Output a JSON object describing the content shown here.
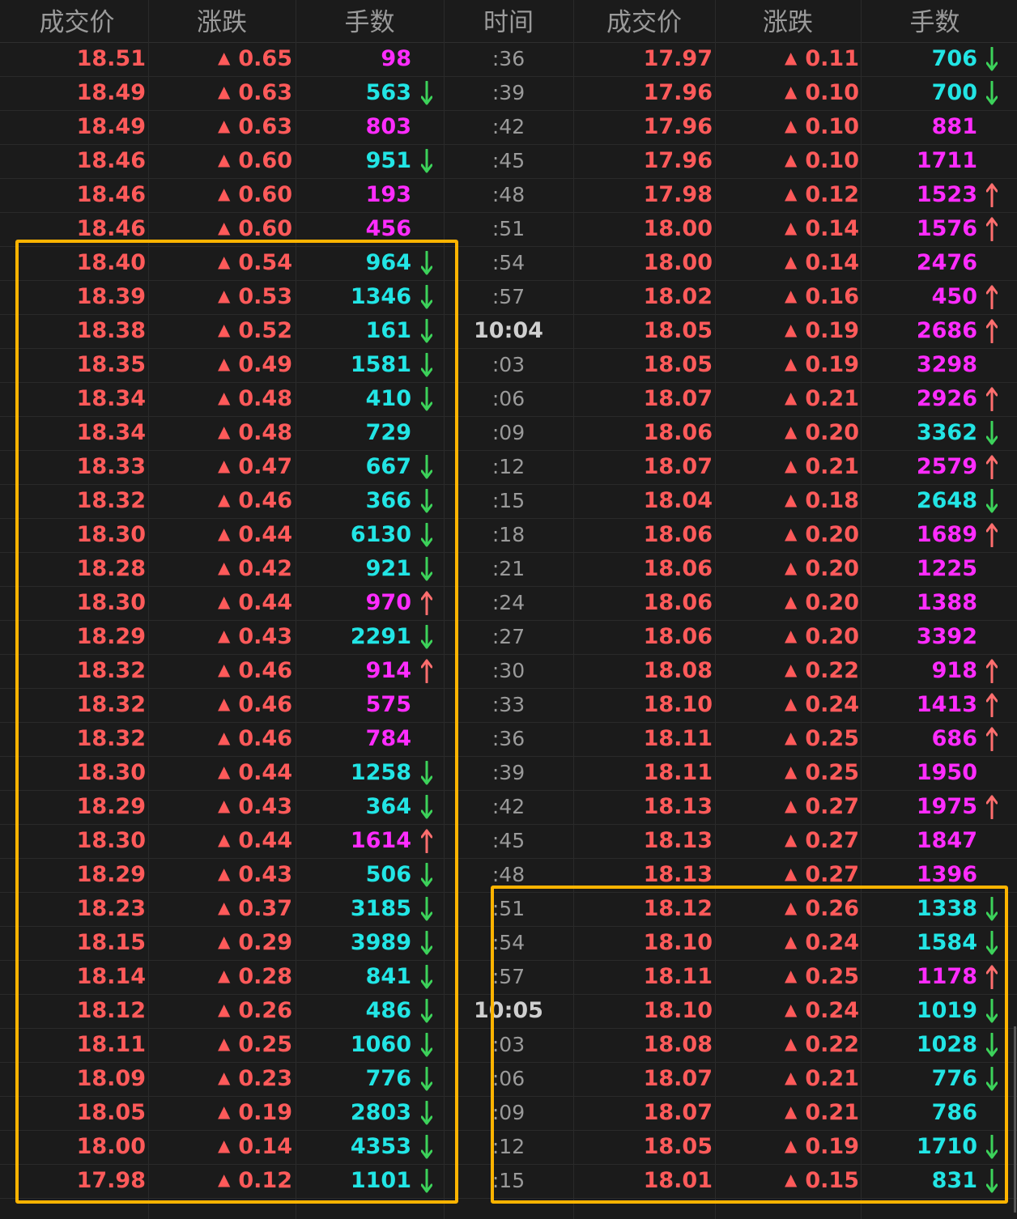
{
  "headers": {
    "price": "成交价",
    "change": "涨跌",
    "volume": "手数",
    "time": "时间"
  },
  "colors": {
    "up": "#ff5a5a",
    "buy_volume": "#ff2cff",
    "sell_volume": "#22e5e5",
    "up_arrow": "#ff6e6e",
    "down_arrow": "#3cd25a",
    "highlight": "#ffb400",
    "background": "#1b1b1b"
  },
  "change_icon": "up-triangle-icon",
  "rows": [
    {
      "lp": "18.51",
      "lc": "0.65",
      "lv": "98",
      "lk": "buy",
      "la": "",
      "t": ":36",
      "rp": "17.97",
      "rc": "0.11",
      "rv": "706",
      "rk": "sell",
      "ra": "down"
    },
    {
      "lp": "18.49",
      "lc": "0.63",
      "lv": "563",
      "lk": "sell",
      "la": "down",
      "t": ":39",
      "rp": "17.96",
      "rc": "0.10",
      "rv": "700",
      "rk": "sell",
      "ra": "down"
    },
    {
      "lp": "18.49",
      "lc": "0.63",
      "lv": "803",
      "lk": "buy",
      "la": "",
      "t": ":42",
      "rp": "17.96",
      "rc": "0.10",
      "rv": "881",
      "rk": "buy",
      "ra": ""
    },
    {
      "lp": "18.46",
      "lc": "0.60",
      "lv": "951",
      "lk": "sell",
      "la": "down",
      "t": ":45",
      "rp": "17.96",
      "rc": "0.10",
      "rv": "1711",
      "rk": "buy",
      "ra": ""
    },
    {
      "lp": "18.46",
      "lc": "0.60",
      "lv": "193",
      "lk": "buy",
      "la": "",
      "t": ":48",
      "rp": "17.98",
      "rc": "0.12",
      "rv": "1523",
      "rk": "buy",
      "ra": "up"
    },
    {
      "lp": "18.46",
      "lc": "0.60",
      "lv": "456",
      "lk": "buy",
      "la": "",
      "t": ":51",
      "rp": "18.00",
      "rc": "0.14",
      "rv": "1576",
      "rk": "buy",
      "ra": "up"
    },
    {
      "lp": "18.40",
      "lc": "0.54",
      "lv": "964",
      "lk": "sell",
      "la": "down",
      "t": ":54",
      "rp": "18.00",
      "rc": "0.14",
      "rv": "2476",
      "rk": "buy",
      "ra": ""
    },
    {
      "lp": "18.39",
      "lc": "0.53",
      "lv": "1346",
      "lk": "sell",
      "la": "down",
      "t": ":57",
      "rp": "18.02",
      "rc": "0.16",
      "rv": "450",
      "rk": "buy",
      "ra": "up"
    },
    {
      "lp": "18.38",
      "lc": "0.52",
      "lv": "161",
      "lk": "sell",
      "la": "down",
      "t": "10:04",
      "major": true,
      "rp": "18.05",
      "rc": "0.19",
      "rv": "2686",
      "rk": "buy",
      "ra": "up"
    },
    {
      "lp": "18.35",
      "lc": "0.49",
      "lv": "1581",
      "lk": "sell",
      "la": "down",
      "t": ":03",
      "rp": "18.05",
      "rc": "0.19",
      "rv": "3298",
      "rk": "buy",
      "ra": ""
    },
    {
      "lp": "18.34",
      "lc": "0.48",
      "lv": "410",
      "lk": "sell",
      "la": "down",
      "t": ":06",
      "rp": "18.07",
      "rc": "0.21",
      "rv": "2926",
      "rk": "buy",
      "ra": "up"
    },
    {
      "lp": "18.34",
      "lc": "0.48",
      "lv": "729",
      "lk": "sell",
      "la": "",
      "t": ":09",
      "rp": "18.06",
      "rc": "0.20",
      "rv": "3362",
      "rk": "sell",
      "ra": "down"
    },
    {
      "lp": "18.33",
      "lc": "0.47",
      "lv": "667",
      "lk": "sell",
      "la": "down",
      "t": ":12",
      "rp": "18.07",
      "rc": "0.21",
      "rv": "2579",
      "rk": "buy",
      "ra": "up"
    },
    {
      "lp": "18.32",
      "lc": "0.46",
      "lv": "366",
      "lk": "sell",
      "la": "down",
      "t": ":15",
      "rp": "18.04",
      "rc": "0.18",
      "rv": "2648",
      "rk": "sell",
      "ra": "down"
    },
    {
      "lp": "18.30",
      "lc": "0.44",
      "lv": "6130",
      "lk": "sell",
      "la": "down",
      "t": ":18",
      "rp": "18.06",
      "rc": "0.20",
      "rv": "1689",
      "rk": "buy",
      "ra": "up"
    },
    {
      "lp": "18.28",
      "lc": "0.42",
      "lv": "921",
      "lk": "sell",
      "la": "down",
      "t": ":21",
      "rp": "18.06",
      "rc": "0.20",
      "rv": "1225",
      "rk": "buy",
      "ra": ""
    },
    {
      "lp": "18.30",
      "lc": "0.44",
      "lv": "970",
      "lk": "buy",
      "la": "up",
      "t": ":24",
      "rp": "18.06",
      "rc": "0.20",
      "rv": "1388",
      "rk": "buy",
      "ra": ""
    },
    {
      "lp": "18.29",
      "lc": "0.43",
      "lv": "2291",
      "lk": "sell",
      "la": "down",
      "t": ":27",
      "rp": "18.06",
      "rc": "0.20",
      "rv": "3392",
      "rk": "buy",
      "ra": ""
    },
    {
      "lp": "18.32",
      "lc": "0.46",
      "lv": "914",
      "lk": "buy",
      "la": "up",
      "t": ":30",
      "rp": "18.08",
      "rc": "0.22",
      "rv": "918",
      "rk": "buy",
      "ra": "up"
    },
    {
      "lp": "18.32",
      "lc": "0.46",
      "lv": "575",
      "lk": "buy",
      "la": "",
      "t": ":33",
      "rp": "18.10",
      "rc": "0.24",
      "rv": "1413",
      "rk": "buy",
      "ra": "up"
    },
    {
      "lp": "18.32",
      "lc": "0.46",
      "lv": "784",
      "lk": "buy",
      "la": "",
      "t": ":36",
      "rp": "18.11",
      "rc": "0.25",
      "rv": "686",
      "rk": "buy",
      "ra": "up"
    },
    {
      "lp": "18.30",
      "lc": "0.44",
      "lv": "1258",
      "lk": "sell",
      "la": "down",
      "t": ":39",
      "rp": "18.11",
      "rc": "0.25",
      "rv": "1950",
      "rk": "buy",
      "ra": ""
    },
    {
      "lp": "18.29",
      "lc": "0.43",
      "lv": "364",
      "lk": "sell",
      "la": "down",
      "t": ":42",
      "rp": "18.13",
      "rc": "0.27",
      "rv": "1975",
      "rk": "buy",
      "ra": "up"
    },
    {
      "lp": "18.30",
      "lc": "0.44",
      "lv": "1614",
      "lk": "buy",
      "la": "up",
      "t": ":45",
      "rp": "18.13",
      "rc": "0.27",
      "rv": "1847",
      "rk": "buy",
      "ra": ""
    },
    {
      "lp": "18.29",
      "lc": "0.43",
      "lv": "506",
      "lk": "sell",
      "la": "down",
      "t": ":48",
      "rp": "18.13",
      "rc": "0.27",
      "rv": "1396",
      "rk": "buy",
      "ra": ""
    },
    {
      "lp": "18.23",
      "lc": "0.37",
      "lv": "3185",
      "lk": "sell",
      "la": "down",
      "t": ":51",
      "rp": "18.12",
      "rc": "0.26",
      "rv": "1338",
      "rk": "sell",
      "ra": "down"
    },
    {
      "lp": "18.15",
      "lc": "0.29",
      "lv": "3989",
      "lk": "sell",
      "la": "down",
      "t": ":54",
      "rp": "18.10",
      "rc": "0.24",
      "rv": "1584",
      "rk": "sell",
      "ra": "down"
    },
    {
      "lp": "18.14",
      "lc": "0.28",
      "lv": "841",
      "lk": "sell",
      "la": "down",
      "t": ":57",
      "rp": "18.11",
      "rc": "0.25",
      "rv": "1178",
      "rk": "buy",
      "ra": "up"
    },
    {
      "lp": "18.12",
      "lc": "0.26",
      "lv": "486",
      "lk": "sell",
      "la": "down",
      "t": "10:05",
      "major": true,
      "rp": "18.10",
      "rc": "0.24",
      "rv": "1019",
      "rk": "sell",
      "ra": "down"
    },
    {
      "lp": "18.11",
      "lc": "0.25",
      "lv": "1060",
      "lk": "sell",
      "la": "down",
      "t": ":03",
      "rp": "18.08",
      "rc": "0.22",
      "rv": "1028",
      "rk": "sell",
      "ra": "down"
    },
    {
      "lp": "18.09",
      "lc": "0.23",
      "lv": "776",
      "lk": "sell",
      "la": "down",
      "t": ":06",
      "rp": "18.07",
      "rc": "0.21",
      "rv": "776",
      "rk": "sell",
      "ra": "down"
    },
    {
      "lp": "18.05",
      "lc": "0.19",
      "lv": "2803",
      "lk": "sell",
      "la": "down",
      "t": ":09",
      "rp": "18.07",
      "rc": "0.21",
      "rv": "786",
      "rk": "sell",
      "ra": ""
    },
    {
      "lp": "18.00",
      "lc": "0.14",
      "lv": "4353",
      "lk": "sell",
      "la": "down",
      "t": ":12",
      "rp": "18.05",
      "rc": "0.19",
      "rv": "1710",
      "rk": "sell",
      "ra": "down"
    },
    {
      "lp": "17.98",
      "lc": "0.12",
      "lv": "1101",
      "lk": "sell",
      "la": "down",
      "t": ":15",
      "rp": "18.01",
      "rc": "0.15",
      "rv": "831",
      "rk": "sell",
      "ra": "down"
    }
  ]
}
